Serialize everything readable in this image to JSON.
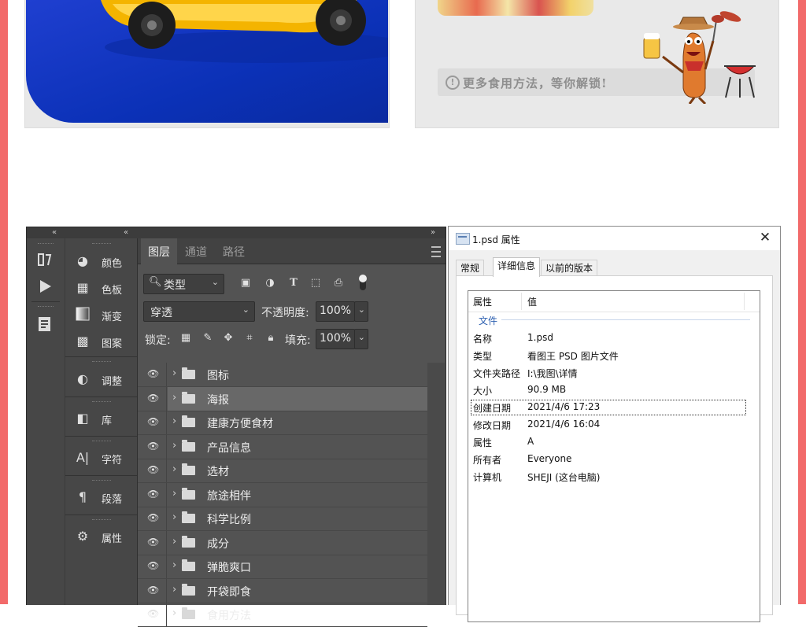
{
  "top_right_card": {
    "hint_icon": "!",
    "hint_text": "更多食用方法，等你解锁!"
  },
  "photoshop": {
    "collapse_left": "«",
    "collapse_mid": "«",
    "collapse_right": "»",
    "tools": [
      "history-brush-icon",
      "play-icon",
      "notes-icon"
    ],
    "panels": [
      {
        "icon": "palette-icon",
        "label": "颜色"
      },
      {
        "icon": "swatches-icon",
        "label": "色板"
      },
      {
        "icon": "gradient-icon",
        "label": "渐变"
      },
      {
        "icon": "patterns-icon",
        "label": "图案"
      },
      {
        "icon": "adjustments-icon",
        "label": "调整"
      },
      {
        "icon": "libraries-icon",
        "label": "库"
      },
      {
        "icon": "character-icon",
        "label": "字符"
      },
      {
        "icon": "paragraph-icon",
        "label": "段落"
      },
      {
        "icon": "properties-icon",
        "label": "属性"
      }
    ],
    "tabs": [
      "图层",
      "通道",
      "路径"
    ],
    "filter": {
      "kind_label": "类型"
    },
    "blend_mode": "穿透",
    "opacity_label": "不透明度:",
    "opacity_value": "100%",
    "lock_label": "锁定:",
    "fill_label": "填充:",
    "fill_value": "100%",
    "layers": [
      "图标",
      "海报",
      "建康方便食材",
      "产品信息",
      "选材",
      "旅途相伴",
      "科学比例",
      "成分",
      "弹脆爽口",
      "开袋即食",
      "食用方法"
    ],
    "selected_layer": 1
  },
  "properties_dialog": {
    "title": "1.psd 属性",
    "close": "✕",
    "tabs": [
      "常规",
      "详细信息",
      "以前的版本"
    ],
    "active_tab": 1,
    "header": {
      "property": "属性",
      "value": "值"
    },
    "group": "文件",
    "rows": [
      {
        "property": "名称",
        "value": "1.psd"
      },
      {
        "property": "类型",
        "value": "看图王 PSD 图片文件"
      },
      {
        "property": "文件夹路径",
        "value": "I:\\我图\\详情"
      },
      {
        "property": "大小",
        "value": "90.9 MB"
      },
      {
        "property": "创建日期",
        "value": "2021/4/6 17:23"
      },
      {
        "property": "修改日期",
        "value": "2021/4/6 16:04"
      },
      {
        "property": "属性",
        "value": "A"
      },
      {
        "property": "所有者",
        "value": "Everyone"
      },
      {
        "property": "计算机",
        "value": "SHEJI (这台电脑)"
      }
    ],
    "focused_row": 4
  }
}
